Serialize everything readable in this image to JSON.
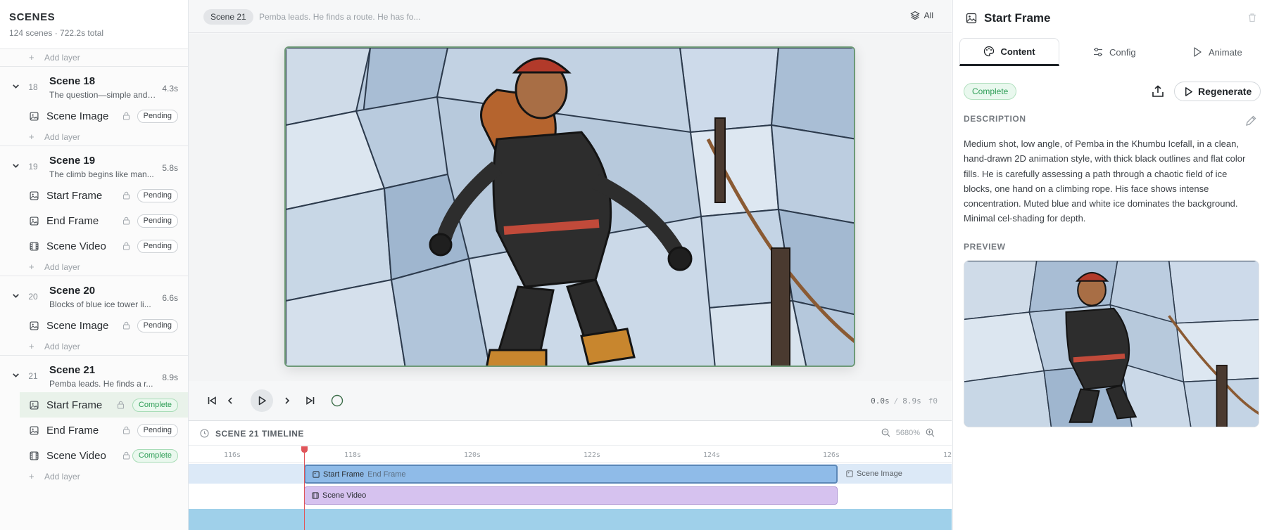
{
  "sidebar": {
    "title": "SCENES",
    "subtitle": "124 scenes · 722.2s total",
    "add_layer": "Add layer",
    "scenes": [
      {
        "num": "18",
        "name": "Scene 18",
        "desc": "The question—simple and ...",
        "duration": "4.3s",
        "layers": [
          {
            "name": "Scene Image",
            "status": "Pending",
            "icon": "image-icon"
          }
        ]
      },
      {
        "num": "19",
        "name": "Scene 19",
        "desc": "The climb begins like man...",
        "duration": "5.8s",
        "layers": [
          {
            "name": "Start Frame",
            "status": "Pending",
            "icon": "image-icon"
          },
          {
            "name": "End Frame",
            "status": "Pending",
            "icon": "image-icon"
          },
          {
            "name": "Scene Video",
            "status": "Pending",
            "icon": "film-icon"
          }
        ]
      },
      {
        "num": "20",
        "name": "Scene 20",
        "desc": "Blocks of blue ice tower li...",
        "duration": "6.6s",
        "layers": [
          {
            "name": "Scene Image",
            "status": "Pending",
            "icon": "image-icon"
          }
        ]
      },
      {
        "num": "21",
        "name": "Scene 21",
        "desc": "Pemba leads. He finds a r...",
        "duration": "8.9s",
        "layers": [
          {
            "name": "Start Frame",
            "status": "Complete",
            "icon": "image-icon",
            "selected": true
          },
          {
            "name": "End Frame",
            "status": "Pending",
            "icon": "image-icon"
          },
          {
            "name": "Scene Video",
            "status": "Complete",
            "icon": "film-icon"
          }
        ]
      }
    ]
  },
  "topbar": {
    "scene_chip": "Scene 21",
    "description": "Pemba leads. He finds a route. He has fo...",
    "layers_toggle": "All"
  },
  "playback": {
    "current": "0.0s",
    "separator": "/",
    "total": "8.9s",
    "frame": "f0"
  },
  "timeline": {
    "title": "SCENE 21 TIMELINE",
    "zoom": "5680%",
    "ticks": [
      "116s",
      "118s",
      "120s",
      "122s",
      "124s",
      "126s",
      "12"
    ],
    "clips": {
      "start_frame": "Start Frame",
      "end_frame": "End Frame",
      "scene_image": "Scene Image",
      "scene_video": "Scene Video"
    }
  },
  "panel": {
    "title": "Start Frame",
    "tabs": [
      "Content",
      "Config",
      "Animate"
    ],
    "active_tab": "Content",
    "status": "Complete",
    "regenerate": "Regenerate",
    "description_label": "DESCRIPTION",
    "description": "Medium shot, low angle, of Pemba in the Khumbu Icefall, in a clean, hand-drawn 2D animation style, with thick black outlines and flat color fills. He is carefully assessing a path through a chaotic field of ice blocks, one hand on a climbing rope. His face shows intense concentration. Muted blue and white ice dominates the background. Minimal cel-shading for depth.",
    "preview_label": "PREVIEW"
  },
  "colors": {
    "accent_green": "#2f9e57",
    "playhead": "#e0555a",
    "clip_image": "#8fbbe8",
    "clip_video": "#d6c2ef",
    "frame_border": "#6e9a78"
  }
}
